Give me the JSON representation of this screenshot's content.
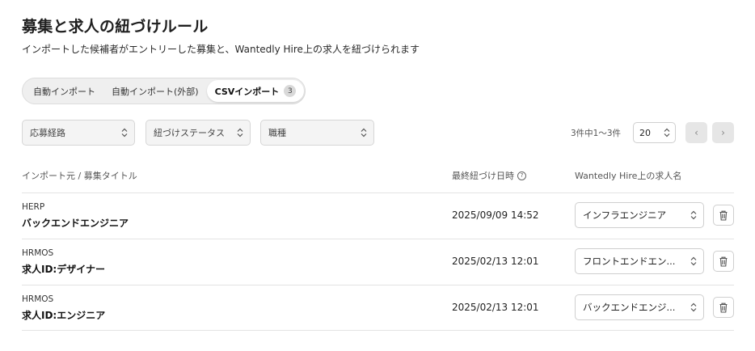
{
  "page": {
    "title": "募集と求人の紐づけルール",
    "description": "インポートした候補者がエントリーした募集と、Wantedly Hire上の求人を紐づけられます"
  },
  "tabs": [
    {
      "label": "自動インポート",
      "active": false
    },
    {
      "label": "自動インポート(外部)",
      "active": false
    },
    {
      "label": "CSVインポート",
      "active": true,
      "count": "3"
    }
  ],
  "filters": {
    "route": "応募経路",
    "status": "紐づけステータス",
    "job_type": "職種"
  },
  "pagination": {
    "count_text": "3件中1〜3件",
    "per_page": "20",
    "prev": "‹",
    "next": "›"
  },
  "table": {
    "headers": [
      "インポート元 / 募集タイトル",
      "最終紐づけ日時",
      "Wantedly Hire上の求人名"
    ],
    "rows": [
      {
        "source": "HERP",
        "title": "バックエンドエンジニア",
        "date": "2025/09/09 14:52",
        "job": "インフラエンジニア"
      },
      {
        "source": "HRMOS",
        "title": "求人ID:デザイナー",
        "date": "2025/02/13 12:01",
        "job": "フロントエンドエン..."
      },
      {
        "source": "HRMOS",
        "title": "求人ID:エンジニア",
        "date": "2025/02/13 12:01",
        "job": "バックエンドエンジ..."
      }
    ]
  },
  "icons": {
    "help": "question-circle-icon",
    "delete": "trash-icon",
    "select": "chevron-updown-icon"
  }
}
